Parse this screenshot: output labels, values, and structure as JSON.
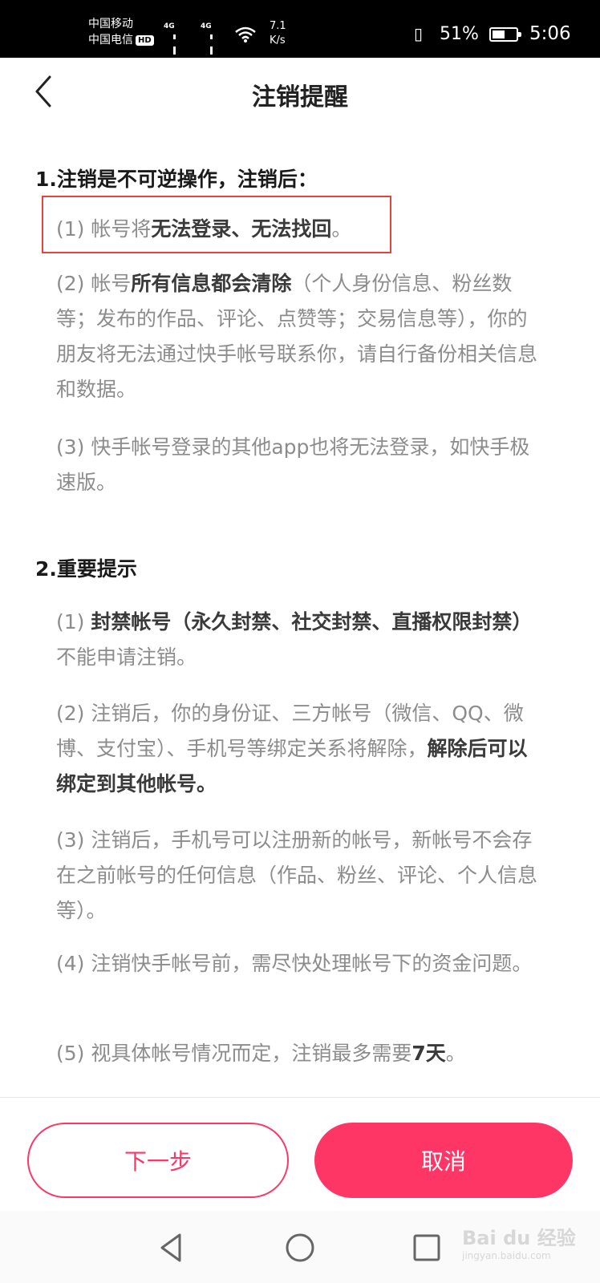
{
  "status_bar": {
    "carrier1": "中国移动",
    "carrier2": "中国电信",
    "hd": "HD",
    "sig1": "4G",
    "sig2": "4G",
    "speed_value": "7.1",
    "speed_unit": "K/s",
    "battery": "51%",
    "time": "5:06"
  },
  "header": {
    "title": "注销提醒"
  },
  "section1": {
    "heading": "1.注销是不可逆操作，注销后：",
    "item1": {
      "prefix": "(1) 帐号将",
      "bold": "无法登录、无法找回",
      "suffix": "。"
    },
    "item2": {
      "prefix": "(2) 帐号",
      "bold": "所有信息都会清除",
      "suffix": "（个人身份信息、粉丝数等；发布的作品、评论、点赞等；交易信息等），你的朋友将无法通过快手帐号联系你，请自行备份相关信息和数据。"
    },
    "item3": {
      "text": "(3) 快手帐号登录的其他app也将无法登录，如快手极速版。"
    }
  },
  "section2": {
    "heading": "2.重要提示",
    "item1": {
      "prefix": "(1) ",
      "bold": "封禁帐号（永久封禁、社交封禁、直播权限封禁）",
      "suffix": "不能申请注销。"
    },
    "item2": {
      "prefix": "(2) 注销后，你的身份证、三方帐号（微信、QQ、微博、支付宝）、手机号等绑定关系将解除，",
      "bold": "解除后可以绑定到其他帐号。",
      "suffix": ""
    },
    "item3": {
      "text": "(3) 注销后，手机号可以注册新的帐号，新帐号不会存在之前帐号的任何信息（作品、粉丝、评论、个人信息等）。"
    },
    "item4": {
      "text": "(4) 注销快手帐号前，需尽快处理帐号下的资金问题。"
    },
    "item5": {
      "prefix": "(5) 视具体帐号情况而定，注销最多需要",
      "bold": "7天",
      "suffix": "。"
    }
  },
  "buttons": {
    "next": "下一步",
    "cancel": "取消"
  },
  "watermark": {
    "brand": "Bai du 经验",
    "domain": "jingyan.baidu.com"
  },
  "colors": {
    "accent": "#fe3666",
    "highlight_box": "#e0463e"
  }
}
